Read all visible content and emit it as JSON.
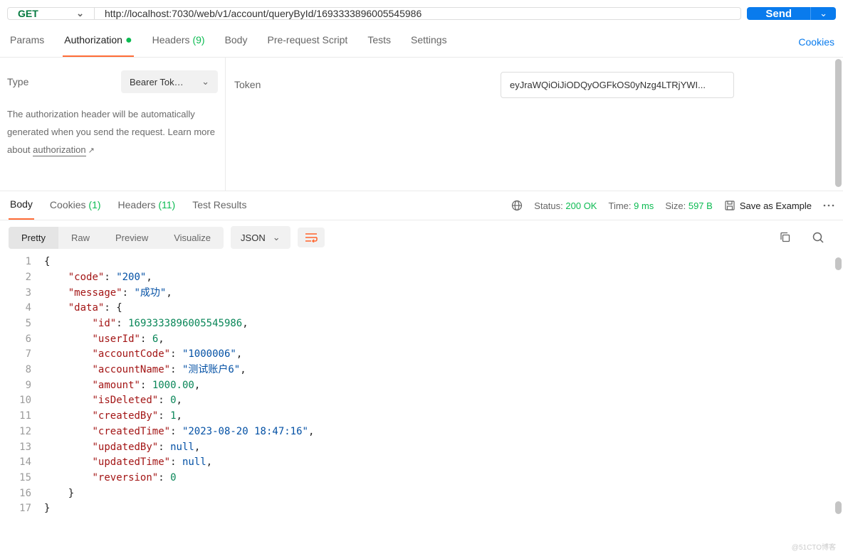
{
  "method": "GET",
  "url": "http://localhost:7030/web/v1/account/queryById/1693333896005545986",
  "send_label": "Send",
  "tabs": {
    "params": "Params",
    "authorization": "Authorization",
    "headers": "Headers",
    "headers_count": "(9)",
    "body": "Body",
    "prerequest": "Pre-request Script",
    "tests": "Tests",
    "settings": "Settings"
  },
  "cookies_link": "Cookies",
  "auth": {
    "type_label": "Type",
    "type_value": "Bearer Tok…",
    "desc_1": "The authorization header will be automatically generated when you send the request. Learn more about ",
    "desc_link": "authorization",
    "token_label": "Token",
    "token_value": "eyJraWQiOiJiODQyOGFkOS0yNzg4LTRjYWI..."
  },
  "resp_tabs": {
    "body": "Body",
    "cookies": "Cookies",
    "cookies_cnt": "(1)",
    "headers": "Headers",
    "headers_cnt": "(11)",
    "test_results": "Test Results"
  },
  "status": {
    "status_label": "Status:",
    "status_value": "200 OK",
    "time_label": "Time:",
    "time_value": "9 ms",
    "size_label": "Size:",
    "size_value": "597 B",
    "save_example": "Save as Example"
  },
  "view_tabs": {
    "pretty": "Pretty",
    "raw": "Raw",
    "preview": "Preview",
    "visualize": "Visualize",
    "json": "JSON"
  },
  "response_json": {
    "code": "200",
    "message": "成功",
    "data": {
      "id": 1693333896005545986,
      "userId": 6,
      "accountCode": "1000006",
      "accountName": "测试账户6",
      "amount": 1000.0,
      "isDeleted": 0,
      "createdBy": 1,
      "createdTime": "2023-08-20 18:47:16",
      "updatedBy": null,
      "updatedTime": null,
      "reversion": 0
    }
  },
  "code_lines": [
    "{",
    "    \"code\": \"200\",",
    "    \"message\": \"成功\",",
    "    \"data\": {",
    "        \"id\": 1693333896005545986,",
    "        \"userId\": 6,",
    "        \"accountCode\": \"1000006\",",
    "        \"accountName\": \"测试账户6\",",
    "        \"amount\": 1000.00,",
    "        \"isDeleted\": 0,",
    "        \"createdBy\": 1,",
    "        \"createdTime\": \"2023-08-20 18:47:16\",",
    "        \"updatedBy\": null,",
    "        \"updatedTime\": null,",
    "        \"reversion\": 0",
    "    }",
    "}"
  ],
  "watermark": "@51CTO博客"
}
